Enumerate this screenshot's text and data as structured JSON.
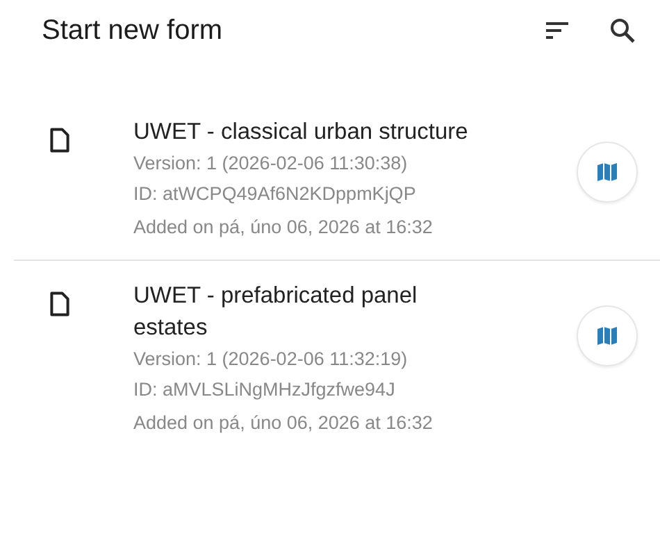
{
  "toolbar": {
    "title": "Start new form"
  },
  "forms": [
    {
      "title": "UWET - classical urban structure",
      "version": "Version: 1 (2026-02-06 11:30:38)",
      "id": "ID: atWCPQ49Af6N2KDppmKjQP",
      "added": "Added on pá, úno 06, 2026 at 16:32"
    },
    {
      "title": "UWET - prefabricated panel estates",
      "version": "Version: 1 (2026-02-06 11:32:19)",
      "id": "ID: aMVLSLiNgMHzJfgzfwe94J",
      "added": "Added on pá, úno 06, 2026 at 16:32"
    }
  ]
}
